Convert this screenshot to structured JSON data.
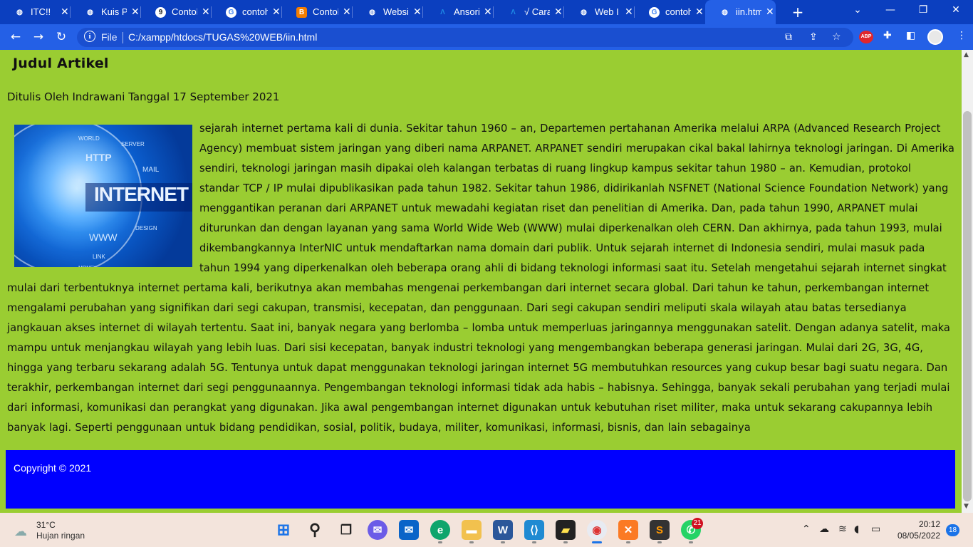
{
  "browser": {
    "tabs": [
      {
        "label": "ITC!!",
        "icon": "globe-icon",
        "color": "#ffffff"
      },
      {
        "label": "Kuis Pr",
        "icon": "globe-icon",
        "color": "#ffffff"
      },
      {
        "label": "Contoh",
        "icon": "nine-icon",
        "color": "#222222"
      },
      {
        "label": "contoh",
        "icon": "google-icon",
        "color": "#ffffff"
      },
      {
        "label": "Contoh",
        "icon": "blogger-icon",
        "color": "#f57d00"
      },
      {
        "label": "Websit",
        "icon": "globe-icon",
        "color": "#ffffff"
      },
      {
        "label": "Ansori",
        "icon": "lambda-icon",
        "color": "#1e88e5"
      },
      {
        "label": "√ Cara",
        "icon": "lambda-icon",
        "color": "#1e88e5"
      },
      {
        "label": "Web I",
        "icon": "globe-icon",
        "color": "#ffffff"
      },
      {
        "label": "contoh",
        "icon": "google-icon",
        "color": "#ffffff"
      },
      {
        "label": "iin.htm",
        "icon": "globe-icon",
        "color": "#ffffff"
      }
    ],
    "address": {
      "file_label": "File",
      "url": "C:/xampp/htdocs/TUGAS%20WEB/iin.html"
    },
    "extensions": {
      "abp_label": "ABP"
    }
  },
  "page": {
    "title": "Judul Artikel",
    "byline": "Ditulis Oleh Indrawani Tanggal 17 September 2021",
    "image": {
      "word": "INTERNET",
      "tags": [
        "WORLD",
        "SERVER",
        "HTTP",
        "MAIL",
        "DESIGN",
        "WWW",
        "LINK",
        "MONEY"
      ]
    },
    "article": "sejarah internet pertama kali di dunia. Sekitar tahun 1960 – an, Departemen pertahanan Amerika melalui ARPA (Advanced Research Project Agency) membuat sistem jaringan yang diberi nama ARPANET. ARPANET sendiri merupakan cikal bakal lahirnya teknologi jaringan. Di Amerika sendiri, teknologi jaringan masih dipakai oleh kalangan terbatas di ruang lingkup kampus sekitar tahun 1980 – an. Kemudian, protokol standar TCP / IP mulai dipublikasikan pada tahun 1982. Sekitar tahun 1986, didirikanlah NSFNET (National Science Foundation Network) yang menggantikan peranan dari ARPANET untuk mewadahi kegiatan riset dan penelitian di Amerika. Dan, pada tahun 1990, ARPANET mulai diturunkan dan dengan layanan yang sama World Wide Web (WWW) mulai diperkenalkan oleh CERN. Dan akhirnya, pada tahun 1993, mulai dikembangkannya InterNIC untuk mendaftarkan nama domain dari publik. Untuk sejarah internet di Indonesia sendiri, mulai masuk pada tahun 1994 yang diperkenalkan oleh beberapa orang ahli di bidang teknologi informasi saat itu. Setelah mengetahui sejarah internet singkat mulai dari terbentuknya internet pertama kali, berikutnya akan membahas mengenai perkembangan dari internet secara global. Dari tahun ke tahun, perkembangan internet mengalami perubahan yang signifikan dari segi cakupan, transmisi, kecepatan, dan penggunaan. Dari segi cakupan sendiri meliputi skala wilayah atau batas tersedianya jangkauan akses internet di wilayah tertentu. Saat ini, banyak negara yang berlomba – lomba untuk memperluas jaringannya menggunakan satelit. Dengan adanya satelit, maka mampu untuk menjangkau wilayah yang lebih luas. Dari sisi kecepatan, banyak industri teknologi yang mengembangkan beberapa generasi jaringan. Mulai dari 2G, 3G, 4G, hingga yang terbaru sekarang adalah 5G. Tentunya untuk dapat menggunakan teknologi jaringan internet 5G membutuhkan resources yang cukup besar bagi suatu negara. Dan terakhir, perkembangan internet dari segi penggunaannya. Pengembangan teknologi informasi tidak ada habis – habisnya. Sehingga, banyak sekali perubahan yang terjadi mulai dari informasi, komunikasi dan perangkat yang digunakan. Jika awal pengembangan internet digunakan untuk kebutuhan riset militer, maka untuk sekarang cakupannya lebih banyak lagi. Seperti penggunaan untuk bidang pendidikan, sosial, politik, budaya, militer, komunikasi, informasi, bisnis, dan lain sebagainya",
    "footer": "Copyright © 2021",
    "colors": {
      "background": "#9acd32",
      "footer": "#0000ff"
    }
  },
  "taskbar": {
    "weather_temp": "31°C",
    "weather_desc": "Hujan ringan",
    "whatsapp_badge": "21",
    "time": "20:12",
    "date": "08/05/2022",
    "notifications": "18"
  }
}
